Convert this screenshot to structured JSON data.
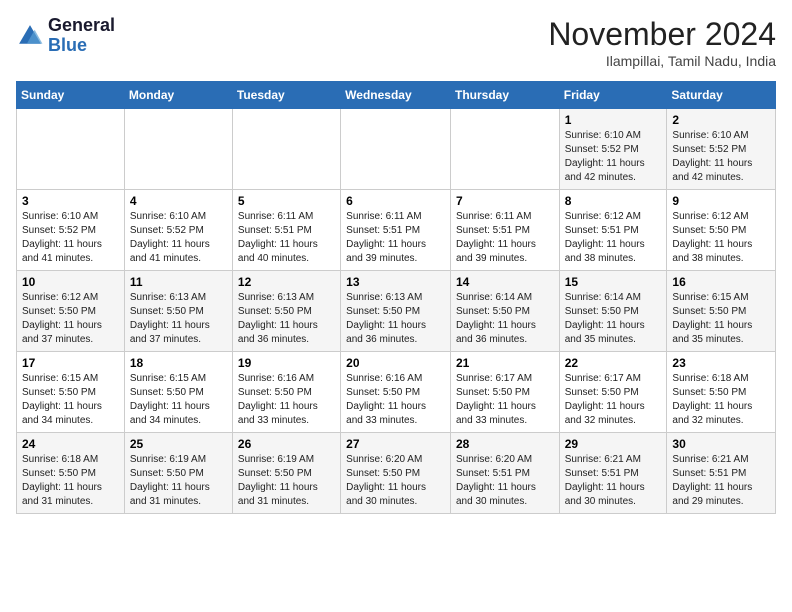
{
  "header": {
    "logo": {
      "line1": "General",
      "line2": "Blue"
    },
    "month_title": "November 2024",
    "location": "Ilampillai, Tamil Nadu, India"
  },
  "weekdays": [
    "Sunday",
    "Monday",
    "Tuesday",
    "Wednesday",
    "Thursday",
    "Friday",
    "Saturday"
  ],
  "weeks": [
    [
      {
        "day": "",
        "info": ""
      },
      {
        "day": "",
        "info": ""
      },
      {
        "day": "",
        "info": ""
      },
      {
        "day": "",
        "info": ""
      },
      {
        "day": "",
        "info": ""
      },
      {
        "day": "1",
        "info": "Sunrise: 6:10 AM\nSunset: 5:52 PM\nDaylight: 11 hours\nand 42 minutes."
      },
      {
        "day": "2",
        "info": "Sunrise: 6:10 AM\nSunset: 5:52 PM\nDaylight: 11 hours\nand 42 minutes."
      }
    ],
    [
      {
        "day": "3",
        "info": "Sunrise: 6:10 AM\nSunset: 5:52 PM\nDaylight: 11 hours\nand 41 minutes."
      },
      {
        "day": "4",
        "info": "Sunrise: 6:10 AM\nSunset: 5:52 PM\nDaylight: 11 hours\nand 41 minutes."
      },
      {
        "day": "5",
        "info": "Sunrise: 6:11 AM\nSunset: 5:51 PM\nDaylight: 11 hours\nand 40 minutes."
      },
      {
        "day": "6",
        "info": "Sunrise: 6:11 AM\nSunset: 5:51 PM\nDaylight: 11 hours\nand 39 minutes."
      },
      {
        "day": "7",
        "info": "Sunrise: 6:11 AM\nSunset: 5:51 PM\nDaylight: 11 hours\nand 39 minutes."
      },
      {
        "day": "8",
        "info": "Sunrise: 6:12 AM\nSunset: 5:51 PM\nDaylight: 11 hours\nand 38 minutes."
      },
      {
        "day": "9",
        "info": "Sunrise: 6:12 AM\nSunset: 5:50 PM\nDaylight: 11 hours\nand 38 minutes."
      }
    ],
    [
      {
        "day": "10",
        "info": "Sunrise: 6:12 AM\nSunset: 5:50 PM\nDaylight: 11 hours\nand 37 minutes."
      },
      {
        "day": "11",
        "info": "Sunrise: 6:13 AM\nSunset: 5:50 PM\nDaylight: 11 hours\nand 37 minutes."
      },
      {
        "day": "12",
        "info": "Sunrise: 6:13 AM\nSunset: 5:50 PM\nDaylight: 11 hours\nand 36 minutes."
      },
      {
        "day": "13",
        "info": "Sunrise: 6:13 AM\nSunset: 5:50 PM\nDaylight: 11 hours\nand 36 minutes."
      },
      {
        "day": "14",
        "info": "Sunrise: 6:14 AM\nSunset: 5:50 PM\nDaylight: 11 hours\nand 36 minutes."
      },
      {
        "day": "15",
        "info": "Sunrise: 6:14 AM\nSunset: 5:50 PM\nDaylight: 11 hours\nand 35 minutes."
      },
      {
        "day": "16",
        "info": "Sunrise: 6:15 AM\nSunset: 5:50 PM\nDaylight: 11 hours\nand 35 minutes."
      }
    ],
    [
      {
        "day": "17",
        "info": "Sunrise: 6:15 AM\nSunset: 5:50 PM\nDaylight: 11 hours\nand 34 minutes."
      },
      {
        "day": "18",
        "info": "Sunrise: 6:15 AM\nSunset: 5:50 PM\nDaylight: 11 hours\nand 34 minutes."
      },
      {
        "day": "19",
        "info": "Sunrise: 6:16 AM\nSunset: 5:50 PM\nDaylight: 11 hours\nand 33 minutes."
      },
      {
        "day": "20",
        "info": "Sunrise: 6:16 AM\nSunset: 5:50 PM\nDaylight: 11 hours\nand 33 minutes."
      },
      {
        "day": "21",
        "info": "Sunrise: 6:17 AM\nSunset: 5:50 PM\nDaylight: 11 hours\nand 33 minutes."
      },
      {
        "day": "22",
        "info": "Sunrise: 6:17 AM\nSunset: 5:50 PM\nDaylight: 11 hours\nand 32 minutes."
      },
      {
        "day": "23",
        "info": "Sunrise: 6:18 AM\nSunset: 5:50 PM\nDaylight: 11 hours\nand 32 minutes."
      }
    ],
    [
      {
        "day": "24",
        "info": "Sunrise: 6:18 AM\nSunset: 5:50 PM\nDaylight: 11 hours\nand 31 minutes."
      },
      {
        "day": "25",
        "info": "Sunrise: 6:19 AM\nSunset: 5:50 PM\nDaylight: 11 hours\nand 31 minutes."
      },
      {
        "day": "26",
        "info": "Sunrise: 6:19 AM\nSunset: 5:50 PM\nDaylight: 11 hours\nand 31 minutes."
      },
      {
        "day": "27",
        "info": "Sunrise: 6:20 AM\nSunset: 5:50 PM\nDaylight: 11 hours\nand 30 minutes."
      },
      {
        "day": "28",
        "info": "Sunrise: 6:20 AM\nSunset: 5:51 PM\nDaylight: 11 hours\nand 30 minutes."
      },
      {
        "day": "29",
        "info": "Sunrise: 6:21 AM\nSunset: 5:51 PM\nDaylight: 11 hours\nand 30 minutes."
      },
      {
        "day": "30",
        "info": "Sunrise: 6:21 AM\nSunset: 5:51 PM\nDaylight: 11 hours\nand 29 minutes."
      }
    ]
  ]
}
